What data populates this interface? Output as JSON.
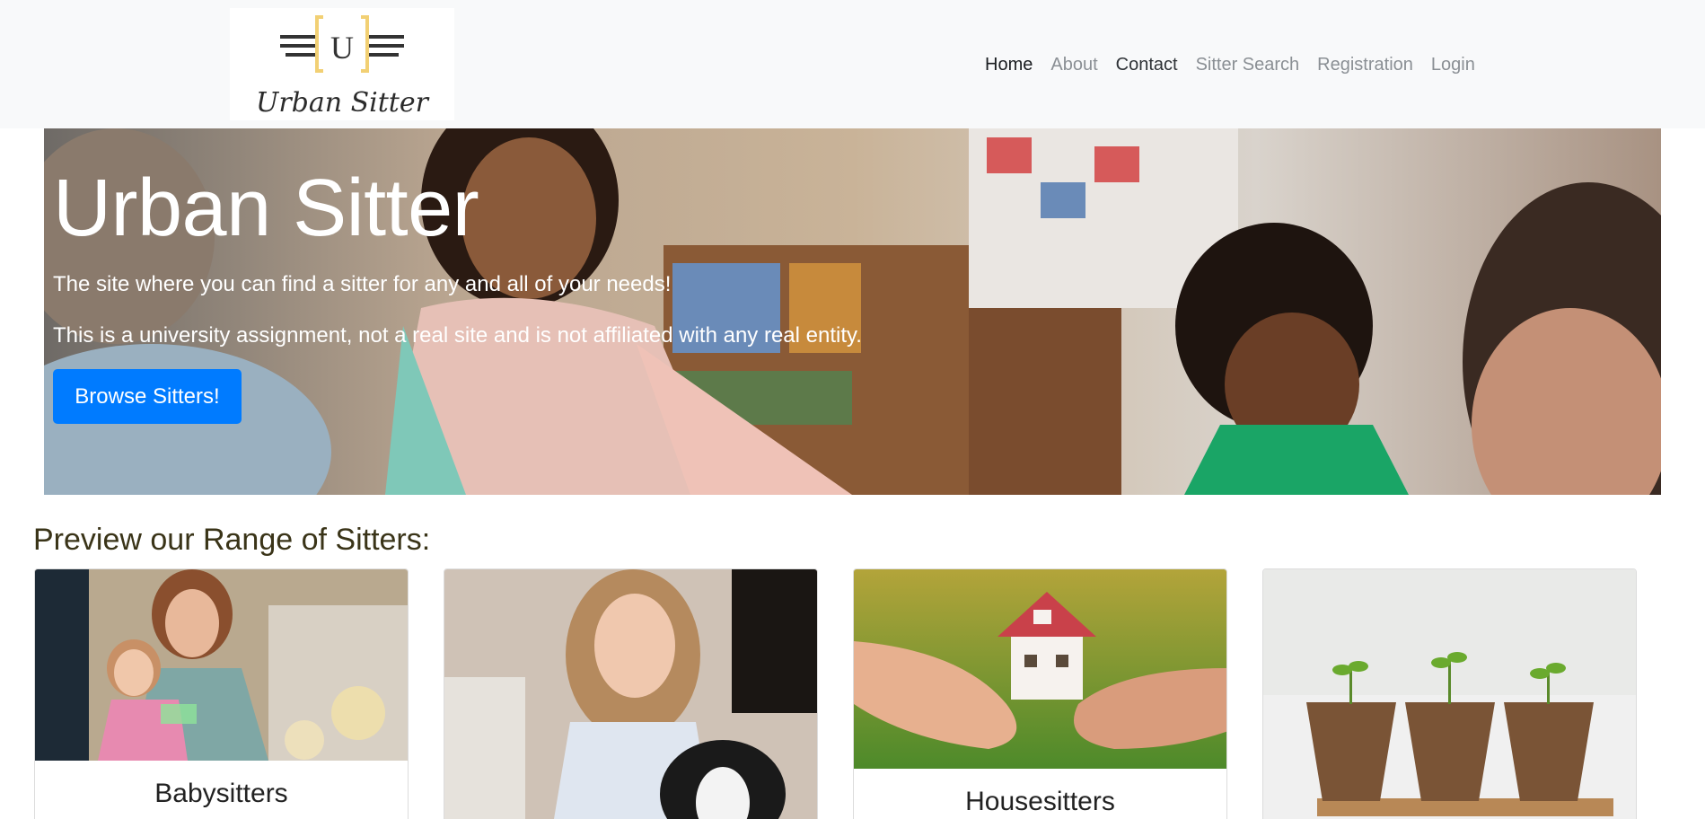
{
  "brand": {
    "logo_letter": "U",
    "logo_name": "Urban Sitter"
  },
  "nav": {
    "items": [
      {
        "label": "Home",
        "state": "active"
      },
      {
        "label": "About",
        "state": "muted"
      },
      {
        "label": "Contact",
        "state": "dark"
      },
      {
        "label": "Sitter Search",
        "state": "muted"
      },
      {
        "label": "Registration",
        "state": "muted"
      },
      {
        "label": "Login",
        "state": "muted"
      }
    ]
  },
  "hero": {
    "title": "Urban Sitter",
    "subtitle": "The site where you can find a sitter for any and all of your needs!",
    "note": "This is a university assignment, not a real site and is not affiliated with any real entity.",
    "button_label": "Browse Sitters!"
  },
  "preview": {
    "heading": "Preview our Range of Sitters:",
    "cards": [
      {
        "title": "Babysitters"
      },
      {
        "title": ""
      },
      {
        "title": "Housesitters"
      },
      {
        "title": ""
      }
    ]
  },
  "colors": {
    "accent": "#007bff",
    "navbar_bg": "#f8f9fa",
    "logo_bracket": "#f2d074"
  }
}
